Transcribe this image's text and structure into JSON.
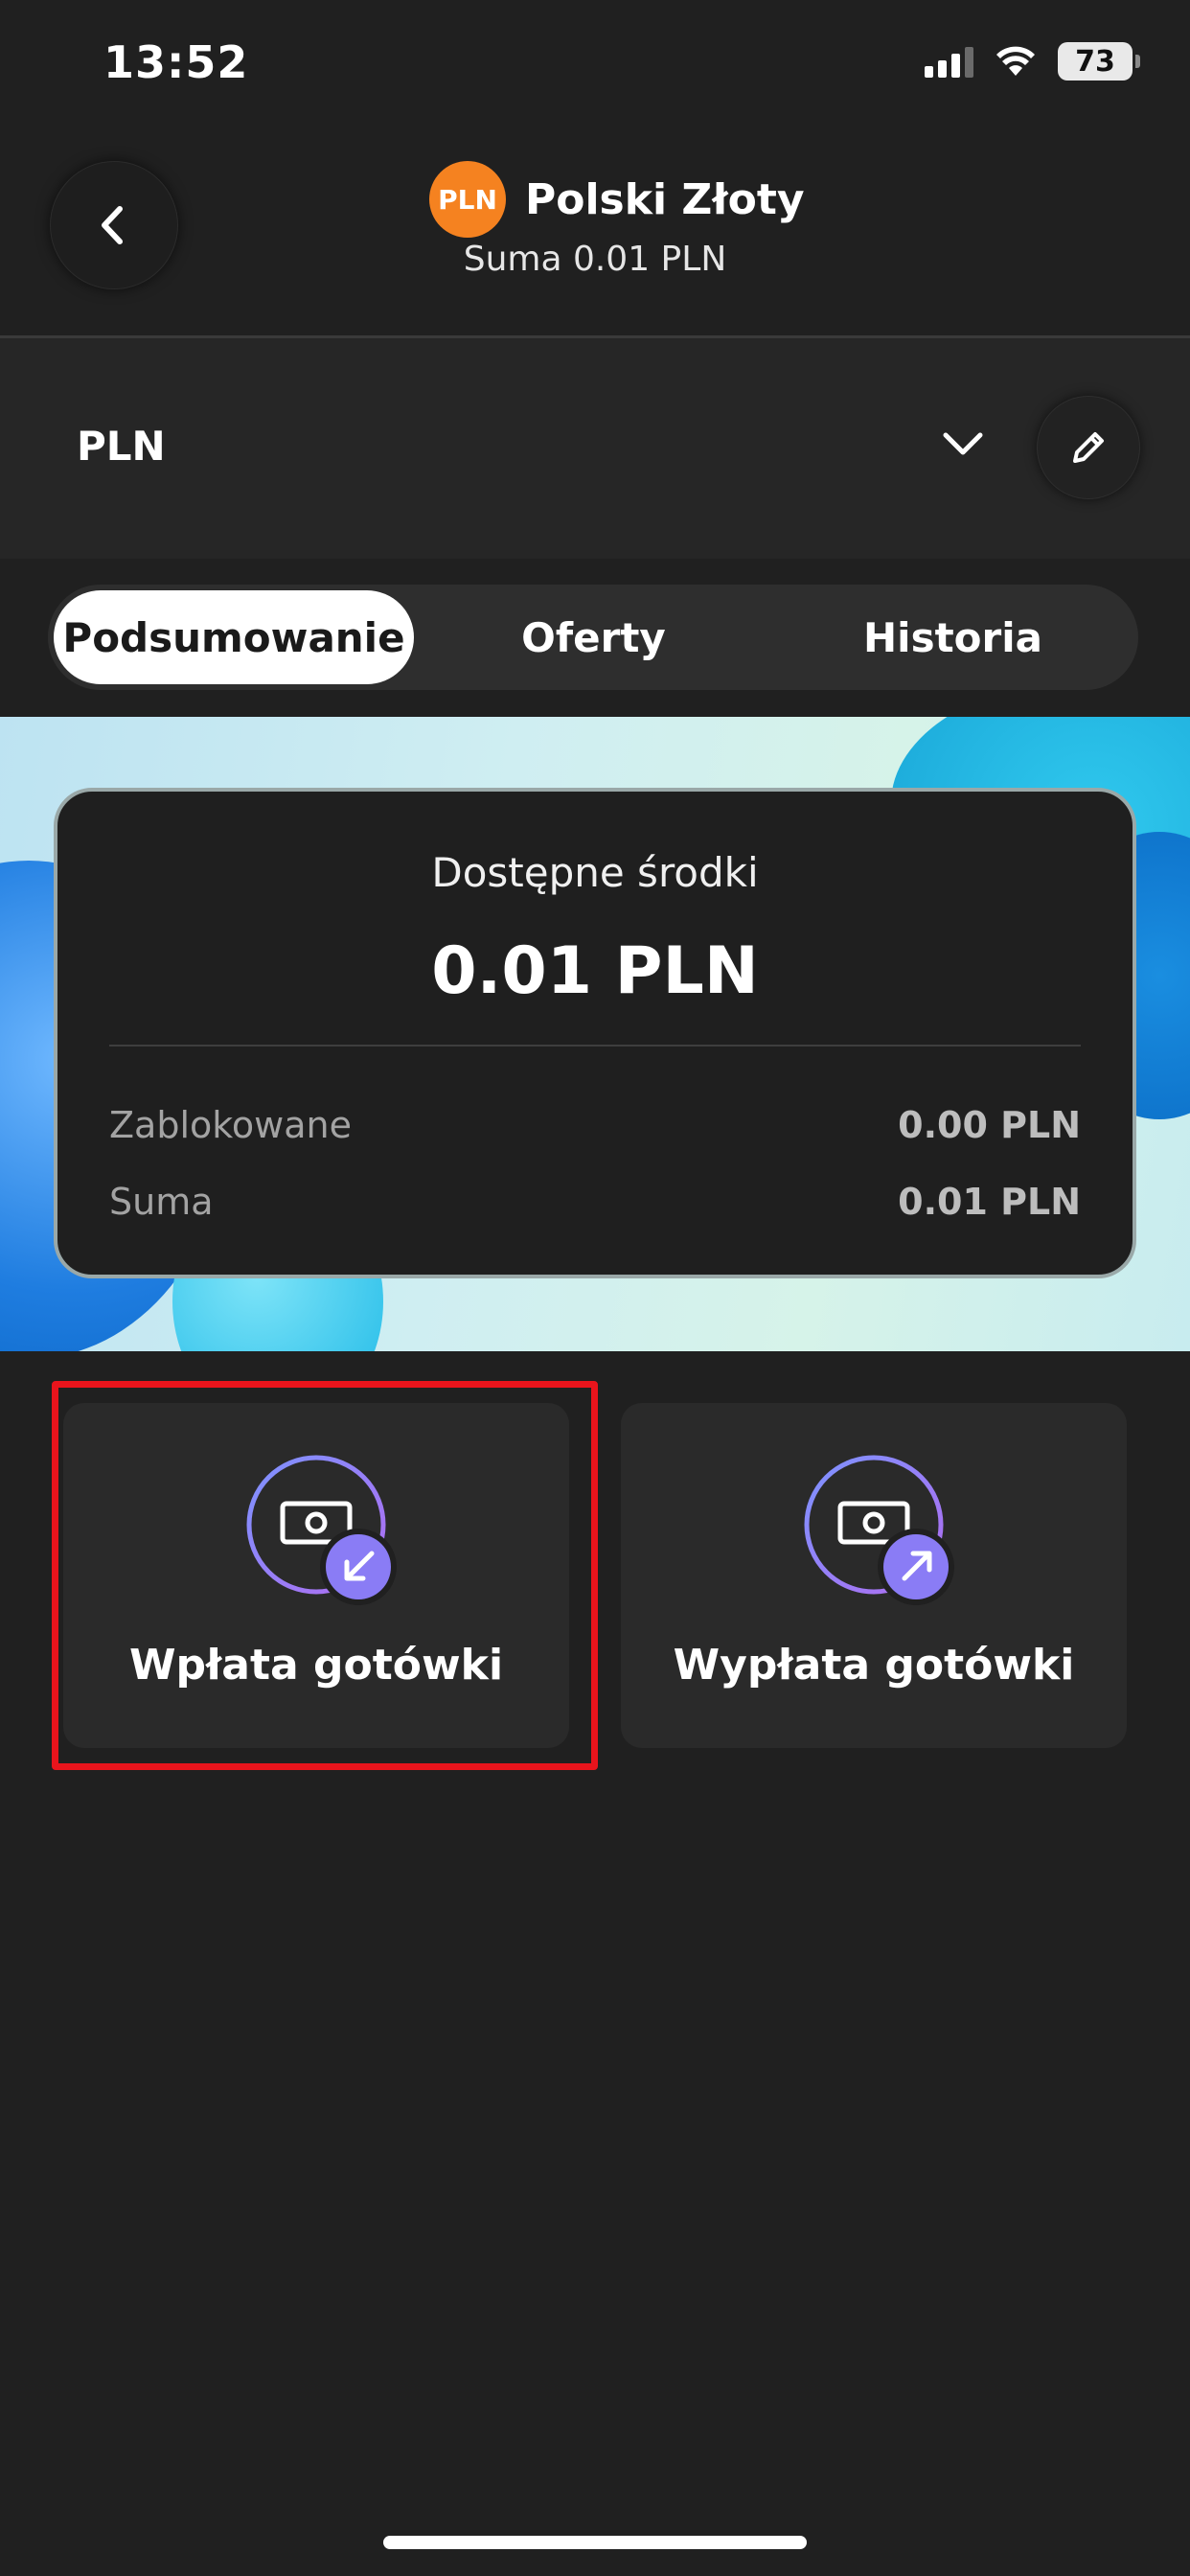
{
  "status_bar": {
    "time": "13:52",
    "battery": "73"
  },
  "header": {
    "currency_badge": "PLN",
    "title": "Polski Złoty",
    "subtitle": "Suma 0.01 PLN"
  },
  "currency_selector": {
    "label": "PLN"
  },
  "tabs": [
    {
      "label": "Podsumowanie",
      "active": true
    },
    {
      "label": "Oferty",
      "active": false
    },
    {
      "label": "Historia",
      "active": false
    }
  ],
  "balance": {
    "available_label": "Dostępne środki",
    "available_value": "0.01 PLN",
    "rows": [
      {
        "label": "Zablokowane",
        "value": "0.00 PLN"
      },
      {
        "label": "Suma",
        "value": "0.01 PLN"
      }
    ]
  },
  "actions": [
    {
      "label": "Wpłata gotówki",
      "icon": "cash-deposit-icon"
    },
    {
      "label": "Wypłata gotówki",
      "icon": "cash-withdrawal-icon"
    }
  ],
  "colors": {
    "accent_orange": "#f58220",
    "highlight_red": "#e8141c",
    "badge_purple": "#8a7cf5"
  }
}
